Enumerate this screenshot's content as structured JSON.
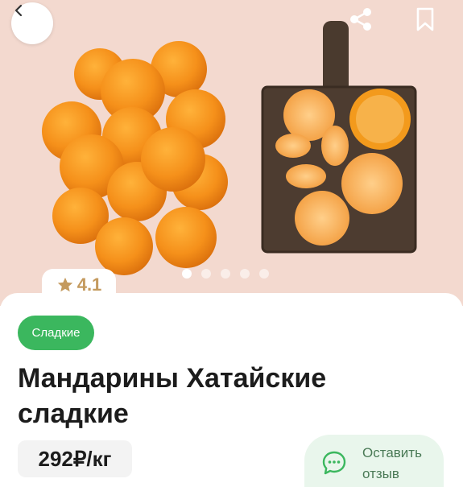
{
  "header": {
    "back_icon": "chevron-left-icon",
    "share_icon": "share-icon",
    "bookmark_icon": "bookmark-icon"
  },
  "gallery": {
    "image": "tangerines-photo",
    "pages": 5,
    "active_page": 1
  },
  "rating": {
    "icon": "star-icon",
    "value": "4.1"
  },
  "product": {
    "tag": "Сладкие",
    "title": "Мандарины Хатайские сладкие",
    "price": "292₽/кг"
  },
  "review_button": {
    "icon": "chat-bubble-icon",
    "label": "Оставить отзыв"
  },
  "colors": {
    "accent_green": "#3bb75e",
    "review_bg": "#e9f6ec",
    "rating_gold": "#c49a5e",
    "hero_bg": "#f3d9cf"
  }
}
